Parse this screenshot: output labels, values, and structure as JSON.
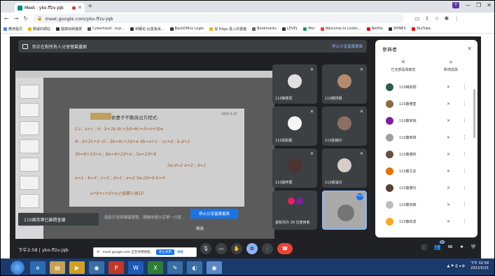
{
  "browser": {
    "tab_title": "Meet - yko-ffzv-jqb",
    "url": "meet.google.com/yko-ffzv-jqb",
    "bookmarks": [
      "應用程式",
      "數據的網站",
      "健康快刷優惠",
      "Cyberhood - ecp...",
      "到蘭花-台農會員...",
      "BackOffice Login",
      "從 Edge 匯入的書籤",
      "Bookmarks",
      "LEVEL",
      "Mor",
      "Welcome to Listen...",
      "Netflix",
      "SPINEX",
      "YouTube"
    ]
  },
  "meet": {
    "share_banner": "你正在對所有人分享螢幕畫面",
    "share_banner_stop": "停止分享螢幕畫面",
    "presentation_caption": "110國英專已離開會議",
    "presentation_note": "投影片請按鍵盤瀏覽，建議你縮分享單一分頁",
    "stop_share_button": "停止分享螢幕畫面",
    "you_label": "略過",
    "slide": {
      "title": "依妻子不動與出方程式:",
      "date": "1050-5-25",
      "lines": [
        "Cu : a+c - H : b+2e     6c+3d=6c+d+e+3be",
        "N : b+2c+d -O : 3b=6c+2d+e    4b=a+1 - cu+d : b-d+2",
        "3b=6+2d+e ; 6e=6+2d+e ; 5e=2d+6",
        "2e-d=2     e+2 ; d=2",
        "a=1 ; b=4 ; c=3 ; d=2 ; e=2     5e-2d=6  b=4",
        "a+b+c+d+e之值最小為10"
      ]
    },
    "tiles": [
      {
        "name": "110陳惠辰"
      },
      {
        "name": "110顏妤穎"
      },
      {
        "name": "110邱柏甄"
      },
      {
        "name": "110莊翰玲"
      },
      {
        "name": "110劉梓蓉"
      },
      {
        "name": "110謝溫均"
      },
      {
        "name": "還有另外 28 位使用者"
      },
      {
        "name": ""
      }
    ],
    "meeting_time": "下午2:58",
    "meeting_code": "yko-ffzv-jqb",
    "participant_count": "34"
  },
  "people_panel": {
    "title": "參與者",
    "action_mute_all": "已全部設為靜音",
    "action_add": "新增成員",
    "participants": [
      {
        "name": "110楊凱翔",
        "color": "#2e5d4b"
      },
      {
        "name": "110蕭雅萱",
        "color": "#8a6d3b"
      },
      {
        "name": "110蕭家皖",
        "color": "#7b1fa2"
      },
      {
        "name": "110蕭琳琪",
        "color": "#9e9e9e"
      },
      {
        "name": "110蕭雅帆",
        "color": "#6d4c41"
      },
      {
        "name": "110蕭芯芸",
        "color": "#ef6c00"
      },
      {
        "name": "110蕭雅均",
        "color": "#5d4037"
      },
      {
        "name": "110蕭悅琳",
        "color": "#bdbdbd"
      },
      {
        "name": "110蕭佑達",
        "color": "#f9a825"
      }
    ]
  },
  "notification": {
    "text": "meet.google.com 正在共用視窗。",
    "stop_button": "停止共用",
    "hide_link": "隱藏"
  },
  "taskbar": {
    "time": "下午 02:58",
    "date": "2022/5/25"
  },
  "colors": {
    "meet_bg": "#202124",
    "accent": "#8ab4f8",
    "hangup": "#ea4335",
    "primary_button": "#1a73e8"
  }
}
